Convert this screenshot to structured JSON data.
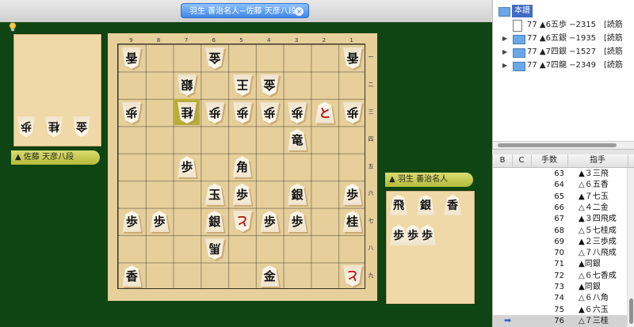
{
  "tab": {
    "title": "羽生 善治名人−佐藤 天彦八段",
    "close_icon": "×"
  },
  "players": {
    "left": {
      "mark": "▲",
      "name": "佐藤 天彦八段"
    },
    "right": {
      "mark": "▲",
      "name": "羽生 善治名人"
    }
  },
  "board": {
    "file_labels": [
      "9",
      "8",
      "7",
      "6",
      "5",
      "4",
      "3",
      "2",
      "1"
    ],
    "rank_labels": [
      "一",
      "二",
      "三",
      "四",
      "五",
      "六",
      "七",
      "八",
      "九"
    ],
    "pieces": [
      {
        "col": 0,
        "row": 0,
        "char": "香",
        "side": "gote"
      },
      {
        "col": 3,
        "row": 0,
        "char": "金",
        "side": "gote"
      },
      {
        "col": 8,
        "row": 0,
        "char": "香",
        "side": "gote"
      },
      {
        "col": 2,
        "row": 1,
        "char": "銀",
        "side": "gote"
      },
      {
        "col": 4,
        "row": 1,
        "char": "王",
        "side": "gote"
      },
      {
        "col": 5,
        "row": 1,
        "char": "金",
        "side": "gote"
      },
      {
        "col": 0,
        "row": 2,
        "char": "歩",
        "side": "gote"
      },
      {
        "col": 2,
        "row": 2,
        "char": "桂",
        "side": "gote"
      },
      {
        "col": 3,
        "row": 2,
        "char": "歩",
        "side": "gote"
      },
      {
        "col": 4,
        "row": 2,
        "char": "歩",
        "side": "gote"
      },
      {
        "col": 5,
        "row": 2,
        "char": "歩",
        "side": "gote"
      },
      {
        "col": 6,
        "row": 2,
        "char": "歩",
        "side": "gote"
      },
      {
        "col": 7,
        "row": 2,
        "char": "と",
        "side": "sente",
        "promoted": true
      },
      {
        "col": 8,
        "row": 2,
        "char": "歩",
        "side": "gote"
      },
      {
        "col": 6,
        "row": 3,
        "char": "竜",
        "side": "sente"
      },
      {
        "col": 2,
        "row": 4,
        "char": "歩",
        "side": "sente"
      },
      {
        "col": 4,
        "row": 4,
        "char": "角",
        "side": "sente"
      },
      {
        "col": 3,
        "row": 5,
        "char": "玉",
        "side": "sente"
      },
      {
        "col": 4,
        "row": 5,
        "char": "歩",
        "side": "sente"
      },
      {
        "col": 6,
        "row": 5,
        "char": "銀",
        "side": "sente"
      },
      {
        "col": 8,
        "row": 5,
        "char": "歩",
        "side": "sente"
      },
      {
        "col": 0,
        "row": 6,
        "char": "歩",
        "side": "sente"
      },
      {
        "col": 1,
        "row": 6,
        "char": "歩",
        "side": "sente"
      },
      {
        "col": 3,
        "row": 6,
        "char": "銀",
        "side": "sente"
      },
      {
        "col": 4,
        "row": 6,
        "char": "と",
        "side": "gote",
        "promoted": true
      },
      {
        "col": 5,
        "row": 6,
        "char": "歩",
        "side": "sente"
      },
      {
        "col": 6,
        "row": 6,
        "char": "歩",
        "side": "sente"
      },
      {
        "col": 8,
        "row": 6,
        "char": "桂",
        "side": "sente"
      },
      {
        "col": 3,
        "row": 7,
        "char": "馬",
        "side": "gote"
      },
      {
        "col": 0,
        "row": 8,
        "char": "香",
        "side": "sente"
      },
      {
        "col": 5,
        "row": 8,
        "char": "金",
        "side": "sente"
      },
      {
        "col": 8,
        "row": 8,
        "char": "と",
        "side": "gote",
        "promoted": true
      }
    ],
    "highlight": {
      "col": 2,
      "row": 2
    }
  },
  "hands": {
    "left": [
      {
        "char": "歩",
        "side": "gote"
      },
      {
        "char": "桂",
        "side": "gote"
      },
      {
        "char": "金",
        "side": "gote"
      }
    ],
    "right_top": [
      {
        "char": "飛",
        "side": "sente"
      },
      {
        "char": "銀",
        "side": "sente"
      },
      {
        "char": "香",
        "side": "sente"
      }
    ],
    "right_bottom": [
      {
        "char": "歩",
        "side": "sente"
      },
      {
        "char": "歩",
        "side": "sente"
      },
      {
        "char": "歩",
        "side": "sente"
      }
    ]
  },
  "tree": {
    "root": "本譜",
    "rows": [
      {
        "type": "doc",
        "text": "77 ▲6五歩 −2315　[読筋"
      },
      {
        "type": "folder",
        "text": "77 ▲6五銀 −1935　[読筋"
      },
      {
        "type": "folder",
        "text": "77 ▲7四銀 −1527　[読筋"
      },
      {
        "type": "folder",
        "text": "77 ▲7四龍 −2349　[読筋"
      }
    ]
  },
  "moves": {
    "headers": [
      "B",
      "C",
      "手数",
      "指手"
    ],
    "current_arrow": "➡",
    "rows": [
      {
        "num": "63",
        "move": "▲３三飛"
      },
      {
        "num": "64",
        "move": "△６五香"
      },
      {
        "num": "65",
        "move": "▲７七玉"
      },
      {
        "num": "66",
        "move": "△４二金"
      },
      {
        "num": "67",
        "move": "▲３四飛成"
      },
      {
        "num": "68",
        "move": "△５七桂成"
      },
      {
        "num": "69",
        "move": "▲２三歩成"
      },
      {
        "num": "70",
        "move": "△７八飛成"
      },
      {
        "num": "71",
        "move": "▲同銀"
      },
      {
        "num": "72",
        "move": "△６七香成"
      },
      {
        "num": "73",
        "move": "▲同銀"
      },
      {
        "num": "74",
        "move": "△６八角"
      },
      {
        "num": "75",
        "move": "▲６六玉"
      },
      {
        "num": "76",
        "move": "△７三桂"
      }
    ]
  }
}
